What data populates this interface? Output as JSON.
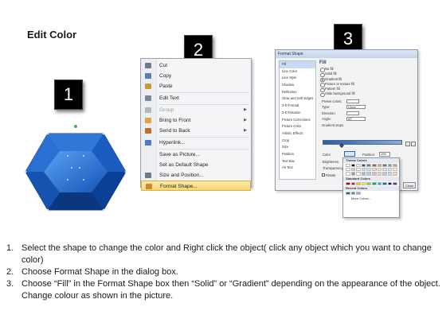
{
  "slide": {
    "title": "Edit Color"
  },
  "badges": [
    "1",
    "2",
    "3"
  ],
  "context_menu": {
    "items": [
      {
        "label": "Cut",
        "icon": "scissors-icon",
        "color": "#6d7b8d",
        "disabled": false,
        "submenu": false
      },
      {
        "label": "Copy",
        "icon": "copy-icon",
        "color": "#5a7db5",
        "disabled": false,
        "submenu": false
      },
      {
        "label": "Paste",
        "icon": "paste-icon",
        "color": "#c69c3d",
        "disabled": false,
        "submenu": false
      },
      {
        "label": "Edit Text",
        "icon": "edit-text-icon",
        "color": "#7a8796",
        "disabled": false,
        "submenu": false
      },
      {
        "label": "Group",
        "icon": "group-icon",
        "color": "#b0b6bd",
        "disabled": true,
        "submenu": true
      },
      {
        "label": "Bring to Front",
        "icon": "bring-front-icon",
        "color": "#e0a63a",
        "disabled": false,
        "submenu": true
      },
      {
        "label": "Send to Back",
        "icon": "send-back-icon",
        "color": "#c46a2a",
        "disabled": false,
        "submenu": true
      },
      {
        "label": "Hyperlink...",
        "icon": "hyperlink-icon",
        "color": "#4a7ac7",
        "disabled": false,
        "submenu": false
      },
      {
        "label": "Save as Picture...",
        "icon": "",
        "color": "",
        "disabled": false,
        "submenu": false
      },
      {
        "label": "Set as Default Shape",
        "icon": "",
        "color": "",
        "disabled": false,
        "submenu": false
      },
      {
        "label": "Size and Position...",
        "icon": "size-position-icon",
        "color": "#6b7a8c",
        "disabled": false,
        "submenu": false
      },
      {
        "label": "Format Shape...",
        "icon": "format-shape-icon",
        "color": "#d08a2a",
        "disabled": false,
        "submenu": false,
        "highlighted": true
      }
    ]
  },
  "format_dialog": {
    "title": "Format Shape",
    "nav": [
      "Fill",
      "Line Color",
      "Line Style",
      "Shadow",
      "Reflection",
      "Glow and Soft Edges",
      "3-D Format",
      "3-D Rotation",
      "Picture Corrections",
      "Picture Color",
      "Artistic Effects",
      "Crop",
      "Size",
      "Position",
      "Text Box",
      "Alt Text"
    ],
    "panel_heading": "Fill",
    "fill_options": [
      "No fill",
      "Solid fill",
      "Gradient fill",
      "Picture or texture fill",
      "Pattern fill",
      "Slide background fill"
    ],
    "fields": [
      {
        "label": "Preset colors:",
        "value": ""
      },
      {
        "label": "Type:",
        "value": "Linear"
      },
      {
        "label": "Direction:",
        "value": ""
      },
      {
        "label": "Angle:",
        "value": "90°"
      }
    ],
    "gradient_stops_label": "Gradient stops",
    "color_label": "Color",
    "position_label": "Position:",
    "position_value": "10%",
    "brightness_label": "Brightness:",
    "transparency_label": "Transparency:",
    "rotate_label": "Rotate",
    "close_label": "Close"
  },
  "palette": {
    "theme_header": "Theme Colors",
    "standard_header": "Standard Colors",
    "recent_header": "Recent Colors",
    "more_label": "More Colors...",
    "theme_top": [
      "#ffffff",
      "#000000",
      "#eeece1",
      "#1f497d",
      "#4f81bd",
      "#c0504d",
      "#9bbb59",
      "#8064a2",
      "#4bacc6",
      "#f79646"
    ],
    "standard": [
      "#c00000",
      "#ff0000",
      "#ffc000",
      "#ffff00",
      "#92d050",
      "#00b050",
      "#00b0f0",
      "#0070c0",
      "#002060",
      "#7030a0"
    ],
    "recent": [
      "#1f5dbd",
      "#4f81bd",
      "#8db3e2"
    ]
  },
  "instructions": [
    "Select the shape to change the color and Right click the object( click any object which you want to change color)",
    "Choose Format Shape in the dialog box.",
    "Choose “Fill” in the Format Shape box then “Solid” or “Gradient” depending on the appearance of the object. Change colour as shown in the picture."
  ]
}
